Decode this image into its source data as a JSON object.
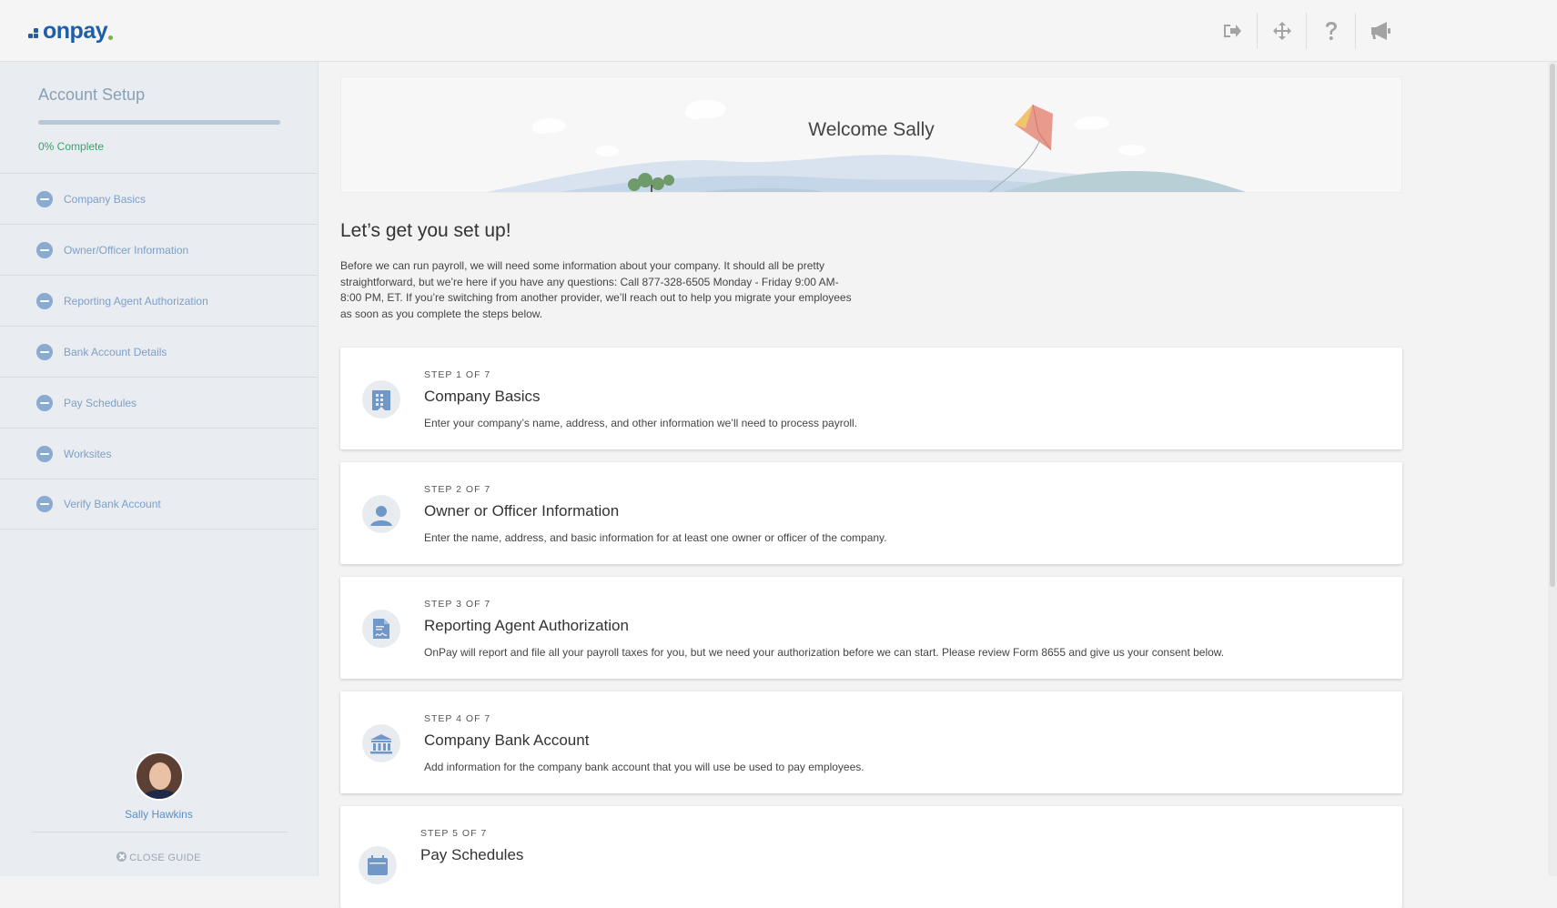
{
  "brand": {
    "name": "onpay",
    "color": "#1f5ea8",
    "dot_color": "#7cb342"
  },
  "header": {
    "actions": [
      {
        "icon": "logout-icon",
        "label": "Sign out"
      },
      {
        "icon": "move-icon",
        "label": "Move"
      },
      {
        "icon": "help-icon",
        "label": "Help"
      },
      {
        "icon": "megaphone-icon",
        "label": "Announcements"
      }
    ]
  },
  "sidebar": {
    "title": "Account Setup",
    "progress": 0,
    "progress_label": "0% Complete",
    "items": [
      {
        "label": "Company Basics"
      },
      {
        "label": "Owner/Officer Information"
      },
      {
        "label": "Reporting Agent Authorization"
      },
      {
        "label": "Bank Account Details"
      },
      {
        "label": "Pay Schedules"
      },
      {
        "label": "Worksites"
      },
      {
        "label": "Verify Bank Account"
      }
    ],
    "user_name": "Sally Hawkins",
    "close_label": "CLOSE GUIDE"
  },
  "main": {
    "banner_title": "Welcome Sally",
    "heading": "Let’s get you set up!",
    "intro": "Before we can run payroll, we will need some information about your company. It should all be pretty straightforward, but we’re here if you have any questions: Call 877-328-6505 Monday - Friday 9:00 AM-8:00 PM, ET. If you’re switching from another provider, we’ll reach out to help you migrate your employees as soon as you complete the steps below.",
    "steps": [
      {
        "kicker": "STEP 1 OF 7",
        "title": "Company Basics",
        "description": "Enter your company’s name, address, and other information we’ll need to process payroll.",
        "icon": "building-icon"
      },
      {
        "kicker": "STEP 2 OF 7",
        "title": "Owner or Officer Information",
        "description": "Enter the name, address, and basic information for at least one owner or officer of the company.",
        "icon": "person-icon"
      },
      {
        "kicker": "STEP 3 OF 7",
        "title": "Reporting Agent Authorization",
        "description": "OnPay will report and file all your payroll taxes for you, but we need your authorization before we can start. Please review Form 8655 and give us your consent below.",
        "icon": "signed-document-icon"
      },
      {
        "kicker": "STEP 4 OF 7",
        "title": "Company Bank Account",
        "description": "Add information for the company bank account that you will use be used to pay employees.",
        "icon": "bank-icon"
      },
      {
        "kicker": "STEP 5 OF 7",
        "title": "Pay Schedules",
        "description": "",
        "icon": "calendar-icon"
      }
    ]
  }
}
